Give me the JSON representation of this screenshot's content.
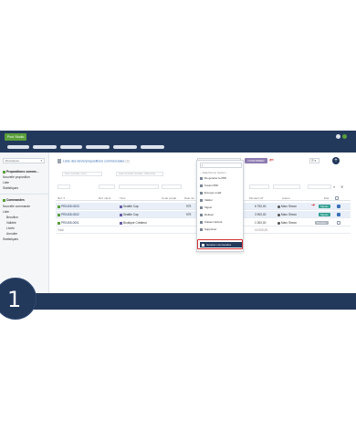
{
  "app": {
    "logo": "Pool Studio"
  },
  "sidebar": {
    "select": "Remarques",
    "sections": [
      {
        "label": "Propositions comme...",
        "items": [
          "Nouvelle proposition",
          "Liste",
          "Statistiques"
        ]
      },
      {
        "label": "Commandes",
        "items": [
          "Nouvelle commande",
          "Liste"
        ],
        "subitems": [
          "Brouillon",
          "Validée",
          "Livrée",
          "Annulée"
        ],
        "after": [
          "Statistiques"
        ]
      }
    ]
  },
  "main": {
    "breadcrumb": "Liste des devis/propositions commerciales",
    "breadcrumb_count": "(3)",
    "generate_select": "Générer commandes",
    "confirm_label": "CONFIRMER",
    "view_select": "☰ ▾",
    "add_label": "+",
    "filters": [
      "Tiers (société, nom)...",
      "Liste d'entités (société, référence)..."
    ],
    "columns": [
      "Réf. ▾",
      "Réf. client",
      "Tiers",
      "Code postal",
      "Date de...",
      "Montant HT",
      "Auteur",
      "État"
    ],
    "rows": [
      {
        "ref": "PR2405-0003",
        "client": "",
        "tiers": "Seattle Cap",
        "cp": "979",
        "amount": "6 750,00",
        "author": "Marc Simon",
        "status": "Signée",
        "status_type": "signed",
        "checked": true
      },
      {
        "ref": "PR2405-0002",
        "client": "",
        "tiers": "Seattle Cap",
        "cp": "979",
        "amount": "3 900,00",
        "author": "Marc Simon",
        "status": "Signée",
        "status_type": "signed",
        "checked": true
      },
      {
        "ref": "PR2405-0001",
        "client": "",
        "tiers": "Boutique Créateur",
        "cp": "",
        "amount": "1 000,00",
        "author": "Marc Simon",
        "status": "Brouillon",
        "status_type": "draft",
        "checked": false
      }
    ],
    "total_label": "Total",
    "total_value": "10 000,00"
  },
  "dropdown": {
    "search": "|",
    "header": "-- Sélectionner l'action --",
    "options": [
      "Re-générer le PDF",
      "Fusion PDF",
      "Envoyer email",
      "Valider",
      "Signer",
      "Refuser",
      "Classer facturé",
      "Supprimer",
      "Générer commandes"
    ],
    "selected_index": 8
  },
  "step": {
    "number": "1"
  },
  "colors": {
    "brand": "#23395b",
    "accent": "#5a9e3a",
    "confirm": "#8d7bb0",
    "alert": "#d32f2f",
    "signed": "#2e9e8f"
  }
}
